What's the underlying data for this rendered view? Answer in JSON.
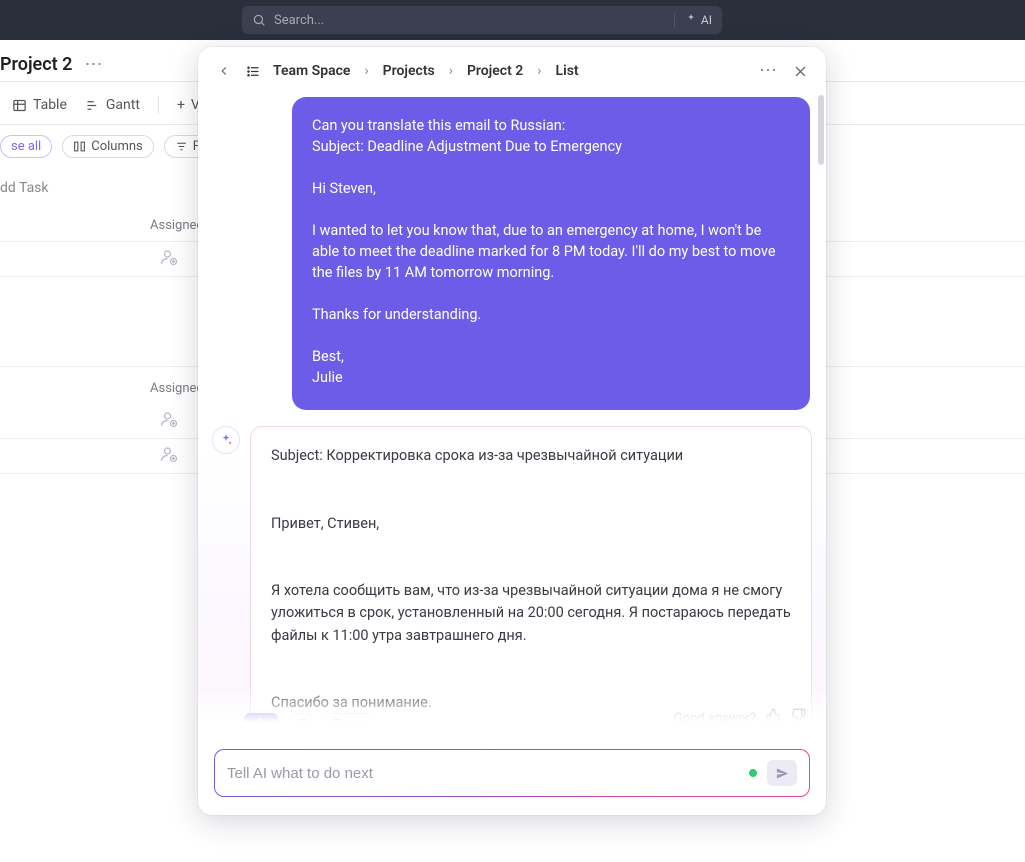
{
  "topbar": {
    "search_placeholder": "Search...",
    "ai_label": "AI"
  },
  "page": {
    "title": "Project 2",
    "tabs": {
      "table": "Table",
      "gantt": "Gantt",
      "view_add": "V"
    },
    "toolbar": {
      "collapse": "se all",
      "columns": "Columns",
      "filters": "Filters"
    },
    "add_task": "dd Task",
    "column_header": "Assignee"
  },
  "modal": {
    "breadcrumb": [
      "Team Space",
      "Projects",
      "Project 2",
      "List"
    ],
    "user_message": "Can you translate this email to Russian:\nSubject: Deadline Adjustment Due to Emergency\n\nHi Steven,\n\nI wanted to let you know that, due to an emergency at home, I won't be able to meet the deadline marked for 8 PM today. I'll do my best to move the files by 11 AM tomorrow morning.\n\nThanks for understanding.\n\nBest,\nJulie",
    "ai_reply": "Subject: Корректировка срока из-за чрезвычайной ситуации\n\n\nПривет, Стивен,\n\n\nЯ хотела сообщить вам, что из-за чрезвычайной ситуации дома я не смогу уложиться в срок, установленный на 20:00 сегодня. Я постараюсь передать файлы к 11:00 утра завтрашнего дня.\n\n\nСпасибо за понимание.\n\n\nС уважением,\nДжули",
    "actions": {
      "primary": "Create",
      "copy": "Copy",
      "regenerate": "Regenerate"
    },
    "feedback_label": "Good answer?",
    "prompt_placeholder": "Tell AI what to do next"
  }
}
